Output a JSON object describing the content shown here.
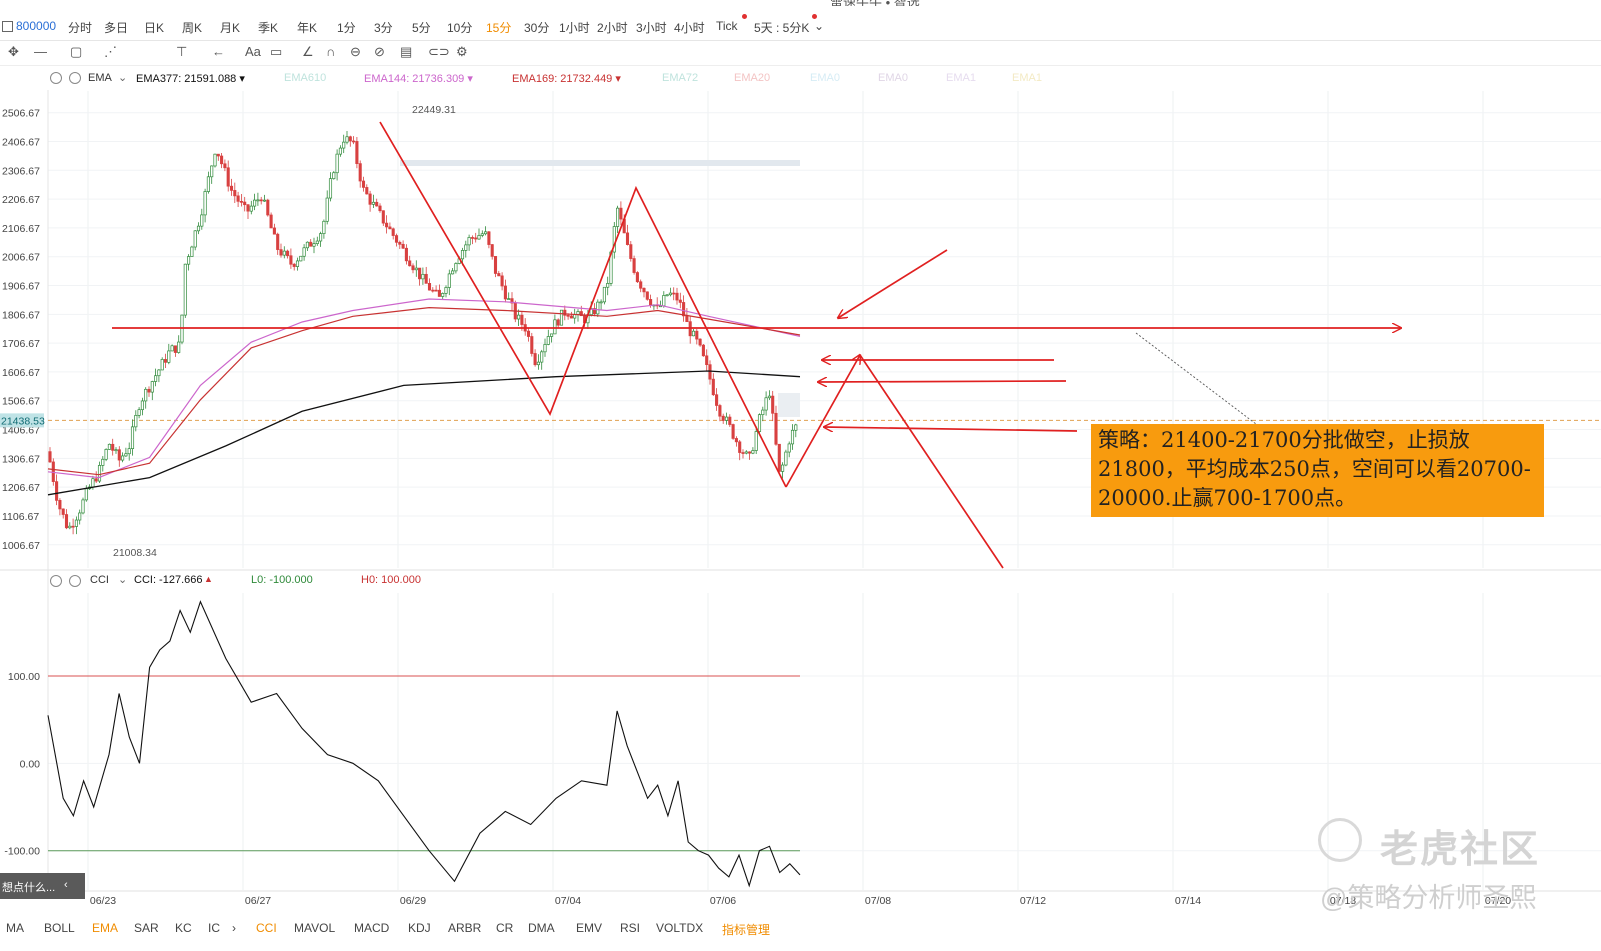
{
  "top": {
    "symbol": "800000",
    "timeframes": [
      "分时",
      "多日",
      "日K",
      "周K",
      "月K",
      "季K",
      "年K",
      "1分",
      "3分",
      "5分",
      "10分",
      "15分",
      "30分",
      "1小时",
      "2小时",
      "3小时",
      "4小时",
      "Tick",
      "5天 : 5分K"
    ],
    "active_timeframe": "15分",
    "title_cut": "雷速牛牛 • 智选"
  },
  "toolbar_icons": [
    "move-icon",
    "line-icon",
    "shape-icon",
    "pattern-icon",
    "fib-icon",
    "arrow-icon",
    "text-icon",
    "comment-icon",
    "ruler-icon",
    "magnet-icon",
    "lock-icon",
    "hide-icon",
    "delete-icon",
    "link-icon",
    "settings-icon"
  ],
  "toolbar_text": "Aa",
  "legend": {
    "indicator": "EMA",
    "items": [
      {
        "text": "EMA377: 21591.088",
        "color": "#111111"
      },
      {
        "text": "EMA610",
        "color": "#bfe3dd"
      },
      {
        "text": "EMA144: 21736.309",
        "color": "#cc66cc"
      },
      {
        "text": "EMA169: 21732.449",
        "color": "#c83232"
      },
      {
        "text": "EMA72",
        "color": "#bfe3dd"
      },
      {
        "text": "EMA20",
        "color": "#f3c4c4"
      },
      {
        "text": "EMA0",
        "color": "#d6ecf5"
      },
      {
        "text": "EMA0",
        "color": "#e0d6e6"
      },
      {
        "text": "EMA1",
        "color": "#e6dcef"
      },
      {
        "text": "EMA1",
        "color": "#f3eac4"
      }
    ]
  },
  "cci_legend": {
    "indicator": "CCI",
    "value": "CCI: -127.666",
    "lo": "L0: -100.000",
    "hi": "H0: 100.000"
  },
  "chart_data": [
    {
      "type": "candlestick",
      "y_ticks": [
        "2506.67",
        "2406.67",
        "2306.67",
        "2206.67",
        "2106.67",
        "2006.67",
        "1906.67",
        "1806.67",
        "1706.67",
        "1606.67",
        "1506.67",
        "1406.67",
        "1306.67",
        "1206.67",
        "1106.67",
        "1006.67"
      ],
      "y_ticks_value": [
        22506.67,
        22406.67,
        22306.67,
        22206.67,
        22106.67,
        22006.67,
        21906.67,
        21806.67,
        21706.67,
        21606.67,
        21506.67,
        21406.67,
        21306.67,
        21206.67,
        21106.67,
        21006.67
      ],
      "ylim": [
        20926,
        22582
      ],
      "x_ticks": [
        "06/23",
        "06/27",
        "06/29",
        "07/04",
        "07/06",
        "07/08",
        "07/12",
        "07/14",
        "07/18",
        "07/20"
      ],
      "current_price": "21438.53",
      "current_value": 21438.53,
      "high_label": "22449.31",
      "high_value": 22449.31,
      "low_label": "21008.34",
      "low_value": 21008.34,
      "close_path": [
        [
          0,
          21330
        ],
        [
          0.02,
          21150
        ],
        [
          0.04,
          21060
        ],
        [
          0.06,
          21120
        ],
        [
          0.08,
          21200
        ],
        [
          0.1,
          21260
        ],
        [
          0.12,
          21360
        ],
        [
          0.14,
          21300
        ],
        [
          0.16,
          21350
        ],
        [
          0.18,
          21500
        ],
        [
          0.2,
          21560
        ],
        [
          0.22,
          21620
        ],
        [
          0.24,
          21680
        ],
        [
          0.26,
          21700
        ],
        [
          0.27,
          21980
        ],
        [
          0.3,
          22150
        ],
        [
          0.33,
          22390
        ],
        [
          0.36,
          22240
        ],
        [
          0.39,
          22160
        ],
        [
          0.42,
          22220
        ],
        [
          0.45,
          22040
        ],
        [
          0.48,
          21980
        ],
        [
          0.51,
          22040
        ],
        [
          0.54,
          22100
        ],
        [
          0.56,
          22300
        ],
        [
          0.58,
          22420
        ],
        [
          0.6,
          22400
        ],
        [
          0.62,
          22240
        ],
        [
          0.65,
          22160
        ],
        [
          0.68,
          22080
        ],
        [
          0.71,
          22000
        ],
        [
          0.74,
          21920
        ],
        [
          0.77,
          21860
        ],
        [
          0.8,
          21990
        ],
        [
          0.83,
          22070
        ],
        [
          0.86,
          22090
        ],
        [
          0.88,
          21960
        ],
        [
          0.9,
          21880
        ],
        [
          0.92,
          21800
        ],
        [
          0.94,
          21760
        ],
        [
          0.96,
          21640
        ],
        [
          0.98,
          21720
        ],
        [
          1.0,
          21780
        ],
        [
          1.02,
          21820
        ],
        [
          1.04,
          21800
        ],
        [
          1.06,
          21790
        ],
        [
          1.08,
          21830
        ],
        [
          1.1,
          21900
        ],
        [
          1.12,
          22180
        ],
        [
          1.14,
          22040
        ],
        [
          1.16,
          21930
        ],
        [
          1.18,
          21870
        ],
        [
          1.2,
          21820
        ],
        [
          1.22,
          21880
        ],
        [
          1.24,
          21860
        ],
        [
          1.26,
          21760
        ],
        [
          1.28,
          21700
        ],
        [
          1.3,
          21600
        ],
        [
          1.32,
          21480
        ],
        [
          1.34,
          21420
        ],
        [
          1.36,
          21350
        ],
        [
          1.38,
          21300
        ],
        [
          1.4,
          21440
        ],
        [
          1.42,
          21540
        ],
        [
          1.44,
          21240
        ],
        [
          1.46,
          21380
        ],
        [
          1.48,
          21440
        ]
      ],
      "ema377": [
        [
          0,
          21180
        ],
        [
          0.2,
          21240
        ],
        [
          0.35,
          21350
        ],
        [
          0.5,
          21470
        ],
        [
          0.7,
          21560
        ],
        [
          1.0,
          21590
        ],
        [
          1.3,
          21610
        ],
        [
          1.48,
          21590
        ]
      ],
      "ema144": [
        [
          0,
          21260
        ],
        [
          0.1,
          21240
        ],
        [
          0.2,
          21310
        ],
        [
          0.3,
          21560
        ],
        [
          0.4,
          21710
        ],
        [
          0.5,
          21780
        ],
        [
          0.6,
          21820
        ],
        [
          0.75,
          21860
        ],
        [
          0.9,
          21850
        ],
        [
          1.1,
          21820
        ],
        [
          1.2,
          21840
        ],
        [
          1.3,
          21800
        ],
        [
          1.48,
          21730
        ]
      ],
      "ema169": [
        [
          0,
          21270
        ],
        [
          0.1,
          21250
        ],
        [
          0.2,
          21290
        ],
        [
          0.3,
          21510
        ],
        [
          0.4,
          21690
        ],
        [
          0.5,
          21750
        ],
        [
          0.6,
          21800
        ],
        [
          0.75,
          21830
        ],
        [
          0.9,
          21820
        ],
        [
          1.1,
          21800
        ],
        [
          1.2,
          21820
        ],
        [
          1.3,
          21790
        ],
        [
          1.48,
          21735
        ]
      ]
    },
    {
      "type": "line",
      "name": "CCI",
      "y_ticks": [
        "100.00",
        "0.00",
        "-100.00"
      ],
      "y_ticks_value": [
        100,
        0,
        -100
      ],
      "ylim": [
        -145,
        195
      ],
      "levels": {
        "hi": 100,
        "lo": -100
      },
      "values": [
        [
          0,
          55
        ],
        [
          0.03,
          -40
        ],
        [
          0.05,
          -60
        ],
        [
          0.07,
          -20
        ],
        [
          0.09,
          -50
        ],
        [
          0.12,
          10
        ],
        [
          0.14,
          80
        ],
        [
          0.16,
          30
        ],
        [
          0.18,
          0
        ],
        [
          0.2,
          110
        ],
        [
          0.22,
          130
        ],
        [
          0.24,
          140
        ],
        [
          0.26,
          175
        ],
        [
          0.28,
          150
        ],
        [
          0.3,
          185
        ],
        [
          0.35,
          120
        ],
        [
          0.4,
          70
        ],
        [
          0.45,
          80
        ],
        [
          0.5,
          40
        ],
        [
          0.55,
          10
        ],
        [
          0.6,
          0
        ],
        [
          0.65,
          -20
        ],
        [
          0.7,
          -60
        ],
        [
          0.75,
          -100
        ],
        [
          0.8,
          -135
        ],
        [
          0.85,
          -80
        ],
        [
          0.9,
          -55
        ],
        [
          0.95,
          -70
        ],
        [
          1.0,
          -40
        ],
        [
          1.05,
          -20
        ],
        [
          1.1,
          -25
        ],
        [
          1.12,
          60
        ],
        [
          1.14,
          20
        ],
        [
          1.16,
          -10
        ],
        [
          1.18,
          -40
        ],
        [
          1.2,
          -25
        ],
        [
          1.22,
          -60
        ],
        [
          1.24,
          -20
        ],
        [
          1.26,
          -90
        ],
        [
          1.28,
          -100
        ],
        [
          1.3,
          -105
        ],
        [
          1.32,
          -120
        ],
        [
          1.34,
          -130
        ],
        [
          1.36,
          -105
        ],
        [
          1.38,
          -140
        ],
        [
          1.4,
          -100
        ],
        [
          1.42,
          -95
        ],
        [
          1.44,
          -125
        ],
        [
          1.46,
          -115
        ],
        [
          1.48,
          -127.666
        ]
      ]
    }
  ],
  "annotations": {
    "strategy_text": "策略：21400-21700分批做空，止损放21800，平均成本250点，空间可以看20700-20000.止赢700-1700点。"
  },
  "bottom": {
    "indicators": [
      "MA",
      "BOLL",
      "EMA",
      "SAR",
      "KC",
      "IC",
      "CCI",
      "MAVOL",
      "MACD",
      "KDJ",
      "ARBR",
      "CR",
      "DMA",
      "EMV",
      "RSI",
      "VOLTDX",
      "指标管理"
    ],
    "active": [
      "EMA",
      "CCI"
    ],
    "hint": "想点什么..."
  },
  "watermark": {
    "brand": "老虎社区",
    "author": "@策略分析师圣熙"
  },
  "colors": {
    "up": "#2f8a3a",
    "down": "#d84040",
    "annotation": "#e02020",
    "orange": "#f89b0e",
    "accent": "#2a6fd6"
  }
}
